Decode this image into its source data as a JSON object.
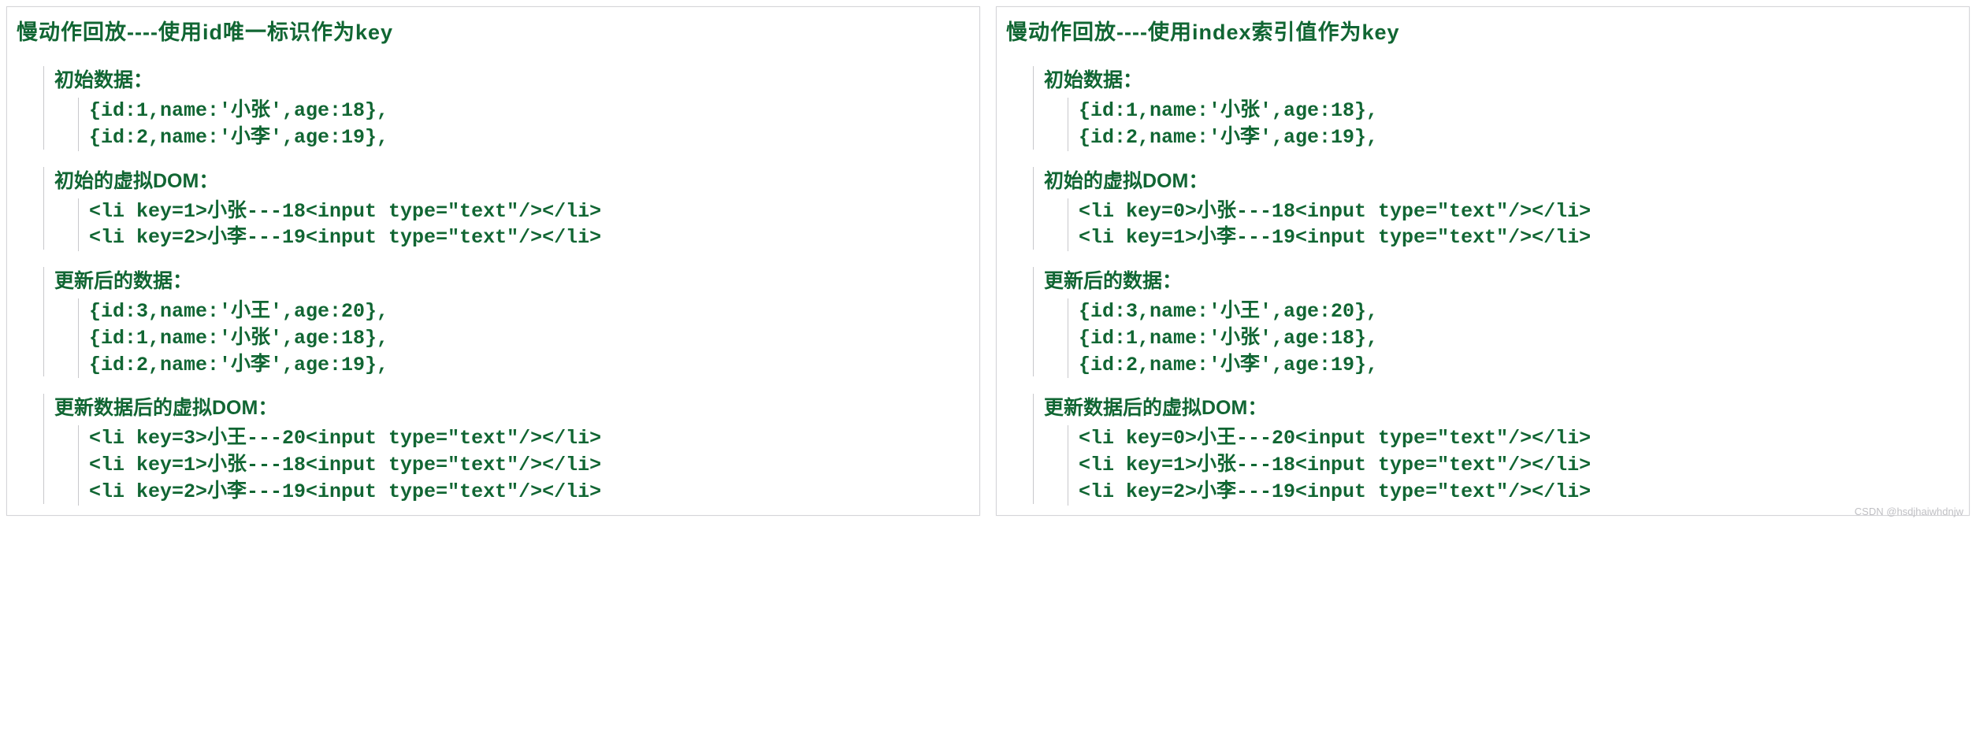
{
  "watermark": "CSDN @hsdjhaiwhdnjw",
  "left": {
    "title": "慢动作回放----使用id唯一标识作为key",
    "sections": [
      {
        "heading": "初始数据：",
        "lines": [
          "{id:1,name:'小张',age:18},",
          "{id:2,name:'小李',age:19},"
        ]
      },
      {
        "heading": "初始的虚拟DOM：",
        "lines": [
          "<li key=1>小张---18<input type=\"text\"/></li>",
          "<li key=2>小李---19<input type=\"text\"/></li>"
        ]
      },
      {
        "heading": "更新后的数据：",
        "lines": [
          "{id:3,name:'小王',age:20},",
          "{id:1,name:'小张',age:18},",
          "{id:2,name:'小李',age:19},"
        ]
      },
      {
        "heading": "更新数据后的虚拟DOM：",
        "lines": [
          "<li key=3>小王---20<input type=\"text\"/></li>",
          "<li key=1>小张---18<input type=\"text\"/></li>",
          "<li key=2>小李---19<input type=\"text\"/></li>"
        ]
      }
    ]
  },
  "right": {
    "title": "慢动作回放----使用index索引值作为key",
    "sections": [
      {
        "heading": "初始数据：",
        "lines": [
          "{id:1,name:'小张',age:18},",
          "{id:2,name:'小李',age:19},"
        ]
      },
      {
        "heading": "初始的虚拟DOM：",
        "lines": [
          "<li key=0>小张---18<input type=\"text\"/></li>",
          "<li key=1>小李---19<input type=\"text\"/></li>"
        ]
      },
      {
        "heading": "更新后的数据：",
        "lines": [
          "{id:3,name:'小王',age:20},",
          "{id:1,name:'小张',age:18},",
          "{id:2,name:'小李',age:19},"
        ]
      },
      {
        "heading": "更新数据后的虚拟DOM：",
        "lines": [
          "<li key=0>小王---20<input type=\"text\"/></li>",
          "<li key=1>小张---18<input type=\"text\"/></li>",
          "<li key=2>小李---19<input type=\"text\"/></li>"
        ]
      }
    ]
  }
}
